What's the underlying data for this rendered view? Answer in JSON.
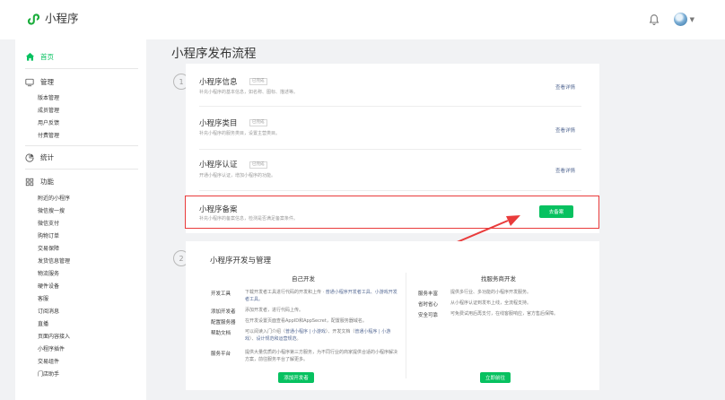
{
  "app": {
    "title": "小程序"
  },
  "sidebar": {
    "home": "首页",
    "sections": [
      {
        "label": "管理",
        "icon": "monitor-icon",
        "items": [
          "版本管理",
          "成员管理",
          "用户反馈",
          "付费管理"
        ]
      },
      {
        "label": "统计",
        "icon": "chart-icon",
        "items": []
      },
      {
        "label": "功能",
        "icon": "grid-icon",
        "items": [
          "附近的小程序",
          "微信搜一搜",
          "微信支付",
          "购物订单",
          "交易保障",
          "发货信息管理",
          "物流服务",
          "硬件设备",
          "客服",
          "订阅消息",
          "直播",
          "页面内容接入",
          "小程序插件",
          "交易组件",
          "门店助手"
        ]
      }
    ]
  },
  "main": {
    "title": "小程序发布流程",
    "step1": {
      "number": "1",
      "rows": [
        {
          "title": "小程序信息",
          "tag": "已完成",
          "desc": "补充小程序的基本信息，如名称、图标、描述等。",
          "link": "查看详情"
        },
        {
          "title": "小程序类目",
          "tag": "已完成",
          "desc": "补充小程序的服务类目，设置主营类目。",
          "link": "查看详情"
        },
        {
          "title": "小程序认证",
          "tag": "已完成",
          "desc": "开通小程序认证，增加小程序的功能。",
          "link": "查看详情"
        },
        {
          "title": "小程序备案",
          "desc": "补充小程序的备案信息，检测是否满足备案条件。",
          "button": "去备案"
        }
      ]
    },
    "step2": {
      "number": "2",
      "title": "小程序开发与管理",
      "left": {
        "heading": "自己开发",
        "items": [
          {
            "key": "开发工具",
            "text": "下载开发者工具进行代码的开发和上传 · ",
            "link": "普通小程序开发者工具、小游戏开发者工具。"
          },
          {
            "key": "添加开发者",
            "text": "添加开发者，进行代码上传。"
          },
          {
            "key": "配置服务器",
            "text": "在开发设置页面查看AppID和AppSecret，配置服务器域名。"
          },
          {
            "key": "帮助文档",
            "text": "可以阅读入门介绍（",
            "link": "普通小程序 | 小游戏",
            "text2": "）、开发文档（",
            "link2": "普通小程序 | 小游戏",
            "text3": "）、",
            "link3": "设计规范和运营规范",
            "text4": "。"
          },
          {
            "key": "服务平台",
            "text": "提供大量优质的小程序第三方服务，为不同行业的商家提供合适的小程序解决方案，前往服务平台了解更多。"
          }
        ],
        "button": "添加开发者"
      },
      "right": {
        "heading": "找服务商开发",
        "items": [
          {
            "key": "服务丰富",
            "text": "提供多行业、多功能的小程序开发服务。"
          },
          {
            "key": "省时省心",
            "text": "从小程序认证到发布上线，全流程支持。"
          },
          {
            "key": "安全可靠",
            "text": "可免费试用后再支付，在线客服响应，官方售后保障。"
          }
        ],
        "button": "立即前往"
      }
    }
  },
  "colors": {
    "accent": "#07c160",
    "link": "#576b95",
    "highlight": "#e93b3b"
  }
}
